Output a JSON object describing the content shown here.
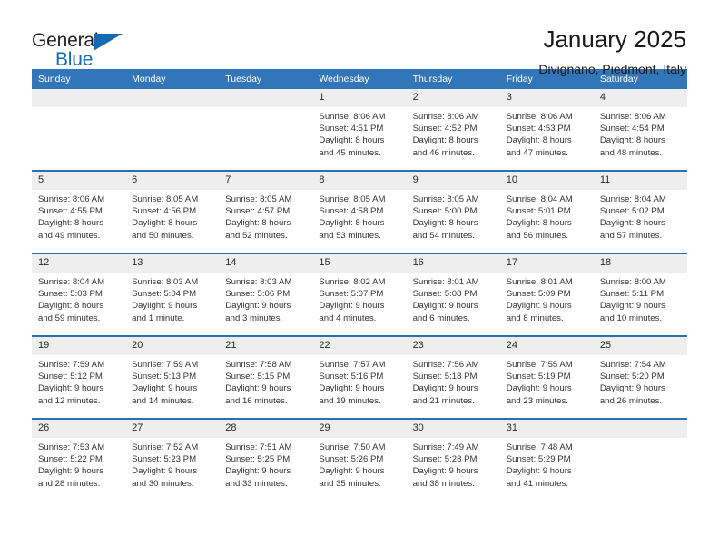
{
  "brand": {
    "name_top": "General",
    "name_bottom": "Blue",
    "accent_color": "#1868b4"
  },
  "header": {
    "title": "January 2025",
    "subtitle": "Divignano, Piedmont, Italy"
  },
  "calendar": {
    "header_bg": "#3275b9",
    "row_divider_color": "#2f6fb0",
    "daynum_bg": "#eeeeee",
    "weekday_headers": [
      "Sunday",
      "Monday",
      "Tuesday",
      "Wednesday",
      "Thursday",
      "Friday",
      "Saturday"
    ],
    "weeks": [
      [
        {
          "day": "",
          "empty": true,
          "sunrise": "",
          "sunset": "",
          "daylight1": "",
          "daylight2": ""
        },
        {
          "day": "",
          "empty": true,
          "sunrise": "",
          "sunset": "",
          "daylight1": "",
          "daylight2": ""
        },
        {
          "day": "",
          "empty": true,
          "sunrise": "",
          "sunset": "",
          "daylight1": "",
          "daylight2": ""
        },
        {
          "day": "1",
          "empty": false,
          "sunrise": "Sunrise: 8:06 AM",
          "sunset": "Sunset: 4:51 PM",
          "daylight1": "Daylight: 8 hours",
          "daylight2": "and 45 minutes."
        },
        {
          "day": "2",
          "empty": false,
          "sunrise": "Sunrise: 8:06 AM",
          "sunset": "Sunset: 4:52 PM",
          "daylight1": "Daylight: 8 hours",
          "daylight2": "and 46 minutes."
        },
        {
          "day": "3",
          "empty": false,
          "sunrise": "Sunrise: 8:06 AM",
          "sunset": "Sunset: 4:53 PM",
          "daylight1": "Daylight: 8 hours",
          "daylight2": "and 47 minutes."
        },
        {
          "day": "4",
          "empty": false,
          "sunrise": "Sunrise: 8:06 AM",
          "sunset": "Sunset: 4:54 PM",
          "daylight1": "Daylight: 8 hours",
          "daylight2": "and 48 minutes."
        }
      ],
      [
        {
          "day": "5",
          "empty": false,
          "sunrise": "Sunrise: 8:06 AM",
          "sunset": "Sunset: 4:55 PM",
          "daylight1": "Daylight: 8 hours",
          "daylight2": "and 49 minutes."
        },
        {
          "day": "6",
          "empty": false,
          "sunrise": "Sunrise: 8:05 AM",
          "sunset": "Sunset: 4:56 PM",
          "daylight1": "Daylight: 8 hours",
          "daylight2": "and 50 minutes."
        },
        {
          "day": "7",
          "empty": false,
          "sunrise": "Sunrise: 8:05 AM",
          "sunset": "Sunset: 4:57 PM",
          "daylight1": "Daylight: 8 hours",
          "daylight2": "and 52 minutes."
        },
        {
          "day": "8",
          "empty": false,
          "sunrise": "Sunrise: 8:05 AM",
          "sunset": "Sunset: 4:58 PM",
          "daylight1": "Daylight: 8 hours",
          "daylight2": "and 53 minutes."
        },
        {
          "day": "9",
          "empty": false,
          "sunrise": "Sunrise: 8:05 AM",
          "sunset": "Sunset: 5:00 PM",
          "daylight1": "Daylight: 8 hours",
          "daylight2": "and 54 minutes."
        },
        {
          "day": "10",
          "empty": false,
          "sunrise": "Sunrise: 8:04 AM",
          "sunset": "Sunset: 5:01 PM",
          "daylight1": "Daylight: 8 hours",
          "daylight2": "and 56 minutes."
        },
        {
          "day": "11",
          "empty": false,
          "sunrise": "Sunrise: 8:04 AM",
          "sunset": "Sunset: 5:02 PM",
          "daylight1": "Daylight: 8 hours",
          "daylight2": "and 57 minutes."
        }
      ],
      [
        {
          "day": "12",
          "empty": false,
          "sunrise": "Sunrise: 8:04 AM",
          "sunset": "Sunset: 5:03 PM",
          "daylight1": "Daylight: 8 hours",
          "daylight2": "and 59 minutes."
        },
        {
          "day": "13",
          "empty": false,
          "sunrise": "Sunrise: 8:03 AM",
          "sunset": "Sunset: 5:04 PM",
          "daylight1": "Daylight: 9 hours",
          "daylight2": "and 1 minute."
        },
        {
          "day": "14",
          "empty": false,
          "sunrise": "Sunrise: 8:03 AM",
          "sunset": "Sunset: 5:06 PM",
          "daylight1": "Daylight: 9 hours",
          "daylight2": "and 3 minutes."
        },
        {
          "day": "15",
          "empty": false,
          "sunrise": "Sunrise: 8:02 AM",
          "sunset": "Sunset: 5:07 PM",
          "daylight1": "Daylight: 9 hours",
          "daylight2": "and 4 minutes."
        },
        {
          "day": "16",
          "empty": false,
          "sunrise": "Sunrise: 8:01 AM",
          "sunset": "Sunset: 5:08 PM",
          "daylight1": "Daylight: 9 hours",
          "daylight2": "and 6 minutes."
        },
        {
          "day": "17",
          "empty": false,
          "sunrise": "Sunrise: 8:01 AM",
          "sunset": "Sunset: 5:09 PM",
          "daylight1": "Daylight: 9 hours",
          "daylight2": "and 8 minutes."
        },
        {
          "day": "18",
          "empty": false,
          "sunrise": "Sunrise: 8:00 AM",
          "sunset": "Sunset: 5:11 PM",
          "daylight1": "Daylight: 9 hours",
          "daylight2": "and 10 minutes."
        }
      ],
      [
        {
          "day": "19",
          "empty": false,
          "sunrise": "Sunrise: 7:59 AM",
          "sunset": "Sunset: 5:12 PM",
          "daylight1": "Daylight: 9 hours",
          "daylight2": "and 12 minutes."
        },
        {
          "day": "20",
          "empty": false,
          "sunrise": "Sunrise: 7:59 AM",
          "sunset": "Sunset: 5:13 PM",
          "daylight1": "Daylight: 9 hours",
          "daylight2": "and 14 minutes."
        },
        {
          "day": "21",
          "empty": false,
          "sunrise": "Sunrise: 7:58 AM",
          "sunset": "Sunset: 5:15 PM",
          "daylight1": "Daylight: 9 hours",
          "daylight2": "and 16 minutes."
        },
        {
          "day": "22",
          "empty": false,
          "sunrise": "Sunrise: 7:57 AM",
          "sunset": "Sunset: 5:16 PM",
          "daylight1": "Daylight: 9 hours",
          "daylight2": "and 19 minutes."
        },
        {
          "day": "23",
          "empty": false,
          "sunrise": "Sunrise: 7:56 AM",
          "sunset": "Sunset: 5:18 PM",
          "daylight1": "Daylight: 9 hours",
          "daylight2": "and 21 minutes."
        },
        {
          "day": "24",
          "empty": false,
          "sunrise": "Sunrise: 7:55 AM",
          "sunset": "Sunset: 5:19 PM",
          "daylight1": "Daylight: 9 hours",
          "daylight2": "and 23 minutes."
        },
        {
          "day": "25",
          "empty": false,
          "sunrise": "Sunrise: 7:54 AM",
          "sunset": "Sunset: 5:20 PM",
          "daylight1": "Daylight: 9 hours",
          "daylight2": "and 26 minutes."
        }
      ],
      [
        {
          "day": "26",
          "empty": false,
          "sunrise": "Sunrise: 7:53 AM",
          "sunset": "Sunset: 5:22 PM",
          "daylight1": "Daylight: 9 hours",
          "daylight2": "and 28 minutes."
        },
        {
          "day": "27",
          "empty": false,
          "sunrise": "Sunrise: 7:52 AM",
          "sunset": "Sunset: 5:23 PM",
          "daylight1": "Daylight: 9 hours",
          "daylight2": "and 30 minutes."
        },
        {
          "day": "28",
          "empty": false,
          "sunrise": "Sunrise: 7:51 AM",
          "sunset": "Sunset: 5:25 PM",
          "daylight1": "Daylight: 9 hours",
          "daylight2": "and 33 minutes."
        },
        {
          "day": "29",
          "empty": false,
          "sunrise": "Sunrise: 7:50 AM",
          "sunset": "Sunset: 5:26 PM",
          "daylight1": "Daylight: 9 hours",
          "daylight2": "and 35 minutes."
        },
        {
          "day": "30",
          "empty": false,
          "sunrise": "Sunrise: 7:49 AM",
          "sunset": "Sunset: 5:28 PM",
          "daylight1": "Daylight: 9 hours",
          "daylight2": "and 38 minutes."
        },
        {
          "day": "31",
          "empty": false,
          "sunrise": "Sunrise: 7:48 AM",
          "sunset": "Sunset: 5:29 PM",
          "daylight1": "Daylight: 9 hours",
          "daylight2": "and 41 minutes."
        },
        {
          "day": "",
          "empty": true,
          "sunrise": "",
          "sunset": "",
          "daylight1": "",
          "daylight2": ""
        }
      ]
    ]
  }
}
